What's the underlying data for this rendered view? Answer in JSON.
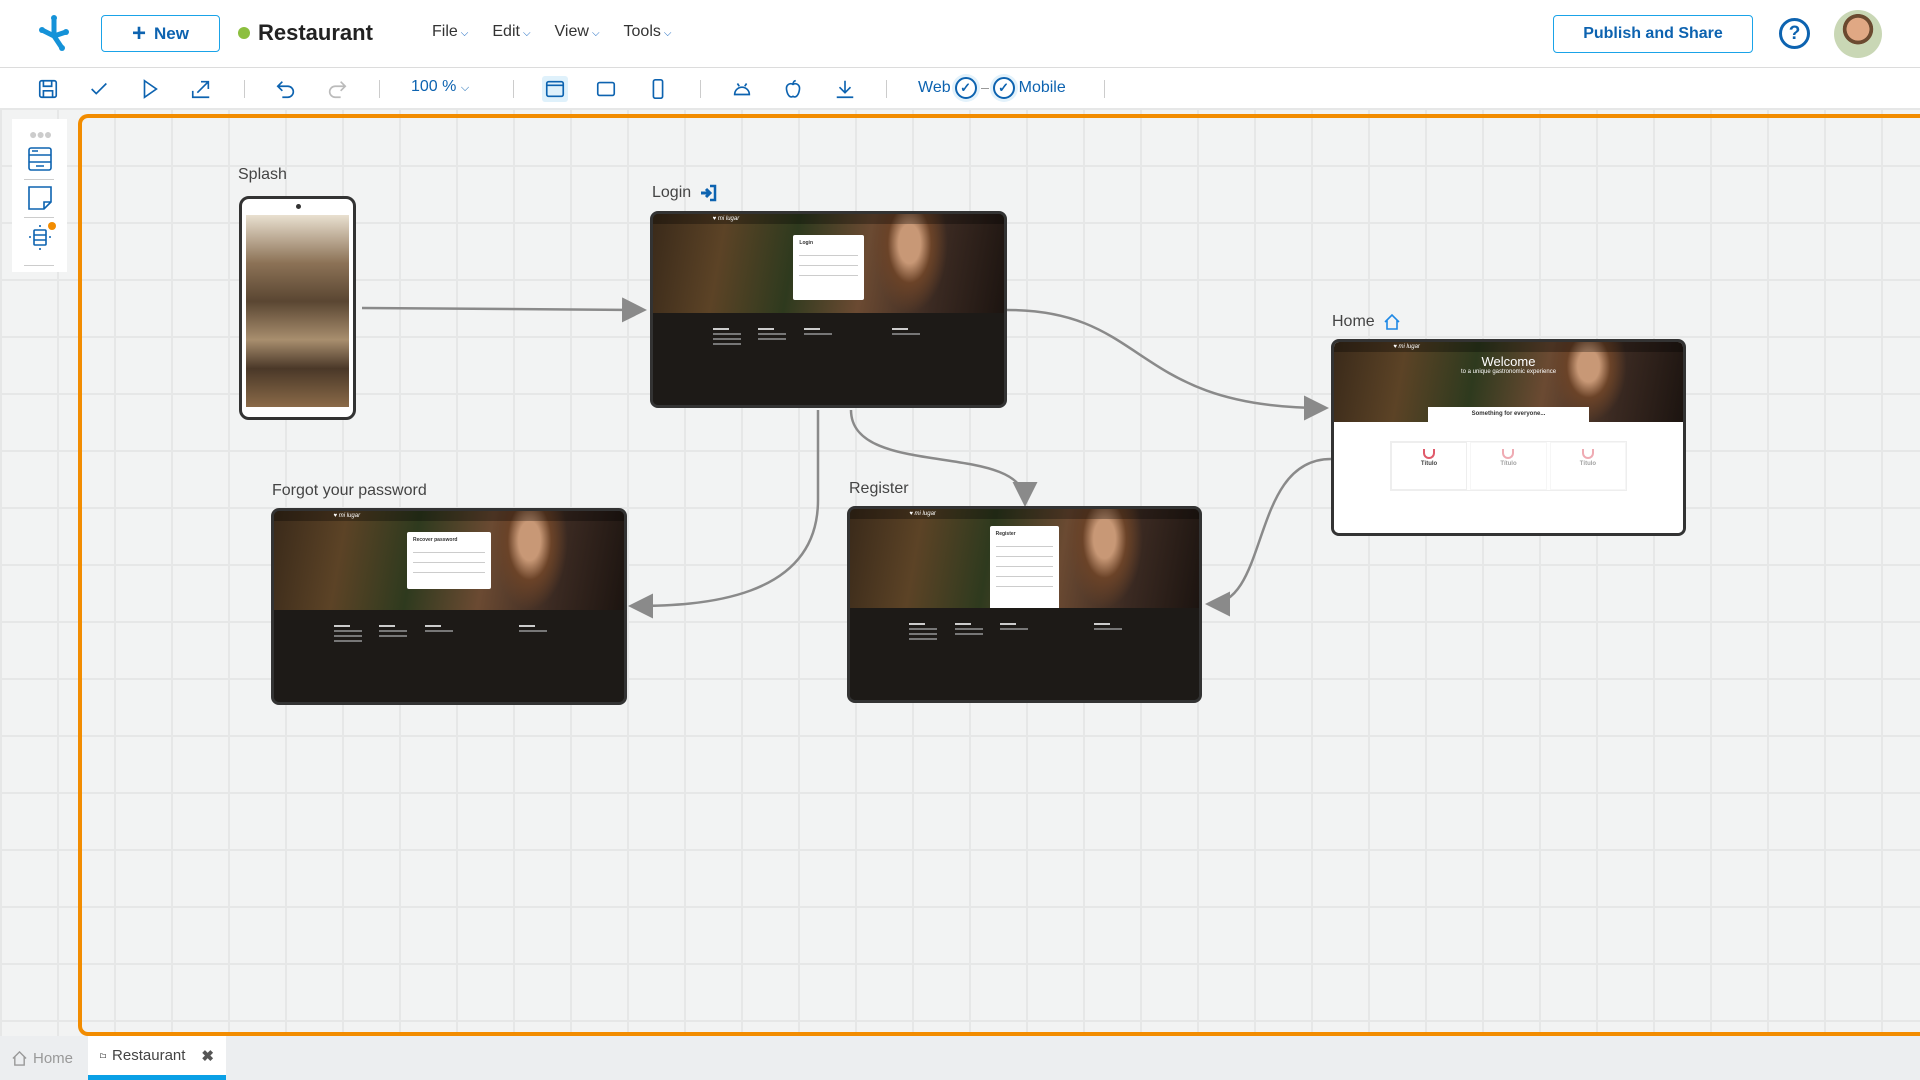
{
  "header": {
    "new_label": "New",
    "project_name": "Restaurant",
    "project_status_color": "#8cbf3f",
    "menus": [
      "File",
      "Edit",
      "View",
      "Tools"
    ],
    "publish_label": "Publish and Share",
    "help_label": "?"
  },
  "toolbar": {
    "zoom": "100 %",
    "web_label": "Web",
    "mobile_label": "Mobile",
    "active_view": "desktop"
  },
  "colors": {
    "accent": "#0d63b0",
    "canvas_border": "#f28c00",
    "tab_indicator": "#0aa0e6"
  },
  "screens": [
    {
      "id": "splash",
      "label": "Splash",
      "type": "mobile"
    },
    {
      "id": "login",
      "label": "Login",
      "icon": "login-icon",
      "card_title": "Login"
    },
    {
      "id": "home",
      "label": "Home",
      "icon": "home-icon",
      "welcome": "Welcome",
      "welcome_sub": "to a unique gastronomic experience",
      "section": "Something for everyone...",
      "tile_title": "Título"
    },
    {
      "id": "forgot",
      "label": "Forgot your password",
      "card_title": "Recover password"
    },
    {
      "id": "register",
      "label": "Register",
      "card_title": "Register"
    }
  ],
  "flows": [
    [
      "splash",
      "login"
    ],
    [
      "login",
      "home"
    ],
    [
      "login",
      "forgot"
    ],
    [
      "login",
      "register"
    ],
    [
      "home",
      "register"
    ]
  ],
  "bottom_tabs": [
    {
      "label": "Home",
      "icon": "home-icon"
    },
    {
      "label": "Restaurant",
      "icon": "folder-icon",
      "active": true
    }
  ]
}
